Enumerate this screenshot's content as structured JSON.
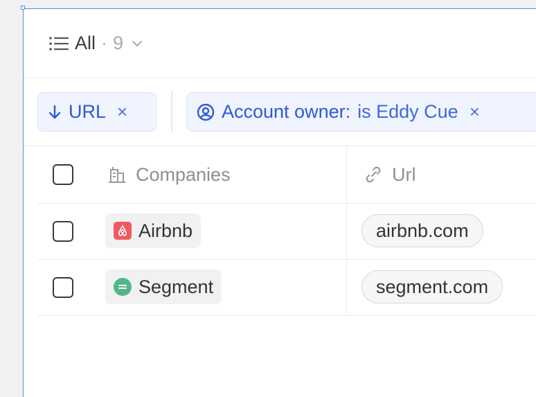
{
  "view": {
    "name": "All",
    "separator": "·",
    "count": "9"
  },
  "sort_chip": {
    "label": "URL",
    "remove": "×"
  },
  "filter_chip": {
    "field": "Account owner:",
    "value": "is Eddy Cue",
    "remove": "×"
  },
  "table": {
    "columns": [
      {
        "label": "Companies",
        "icon": "building-icon"
      },
      {
        "label": "Url",
        "icon": "link-icon"
      }
    ],
    "rows": [
      {
        "company": "Airbnb",
        "logo": "airbnb-logo",
        "url": "airbnb.com"
      },
      {
        "company": "Segment",
        "logo": "segment-logo",
        "url": "segment.com"
      }
    ]
  },
  "colors": {
    "accent": "#2f58d6",
    "chip_bg": "#f0f4ff",
    "selection_border": "#4a90e2",
    "airbnb": "#ef5a60",
    "segment": "#52b788"
  }
}
